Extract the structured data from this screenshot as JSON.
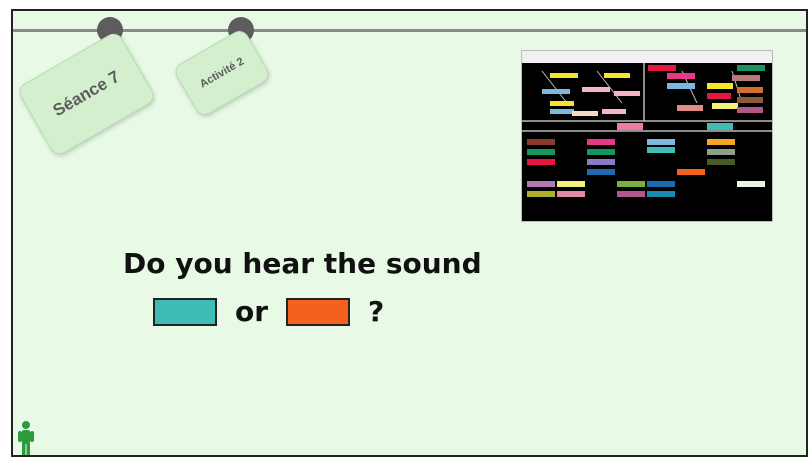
{
  "tags": {
    "seance": "Séance 7",
    "activite": "Activité 2"
  },
  "question": {
    "line1": "Do you hear the sound",
    "or_text": "or",
    "qmark": "?"
  },
  "colors": {
    "teal_swatch": "#3dbdb3",
    "orange_swatch": "#f4601e",
    "background": "#e8fae6"
  },
  "icons": {
    "person": "person-icon"
  }
}
